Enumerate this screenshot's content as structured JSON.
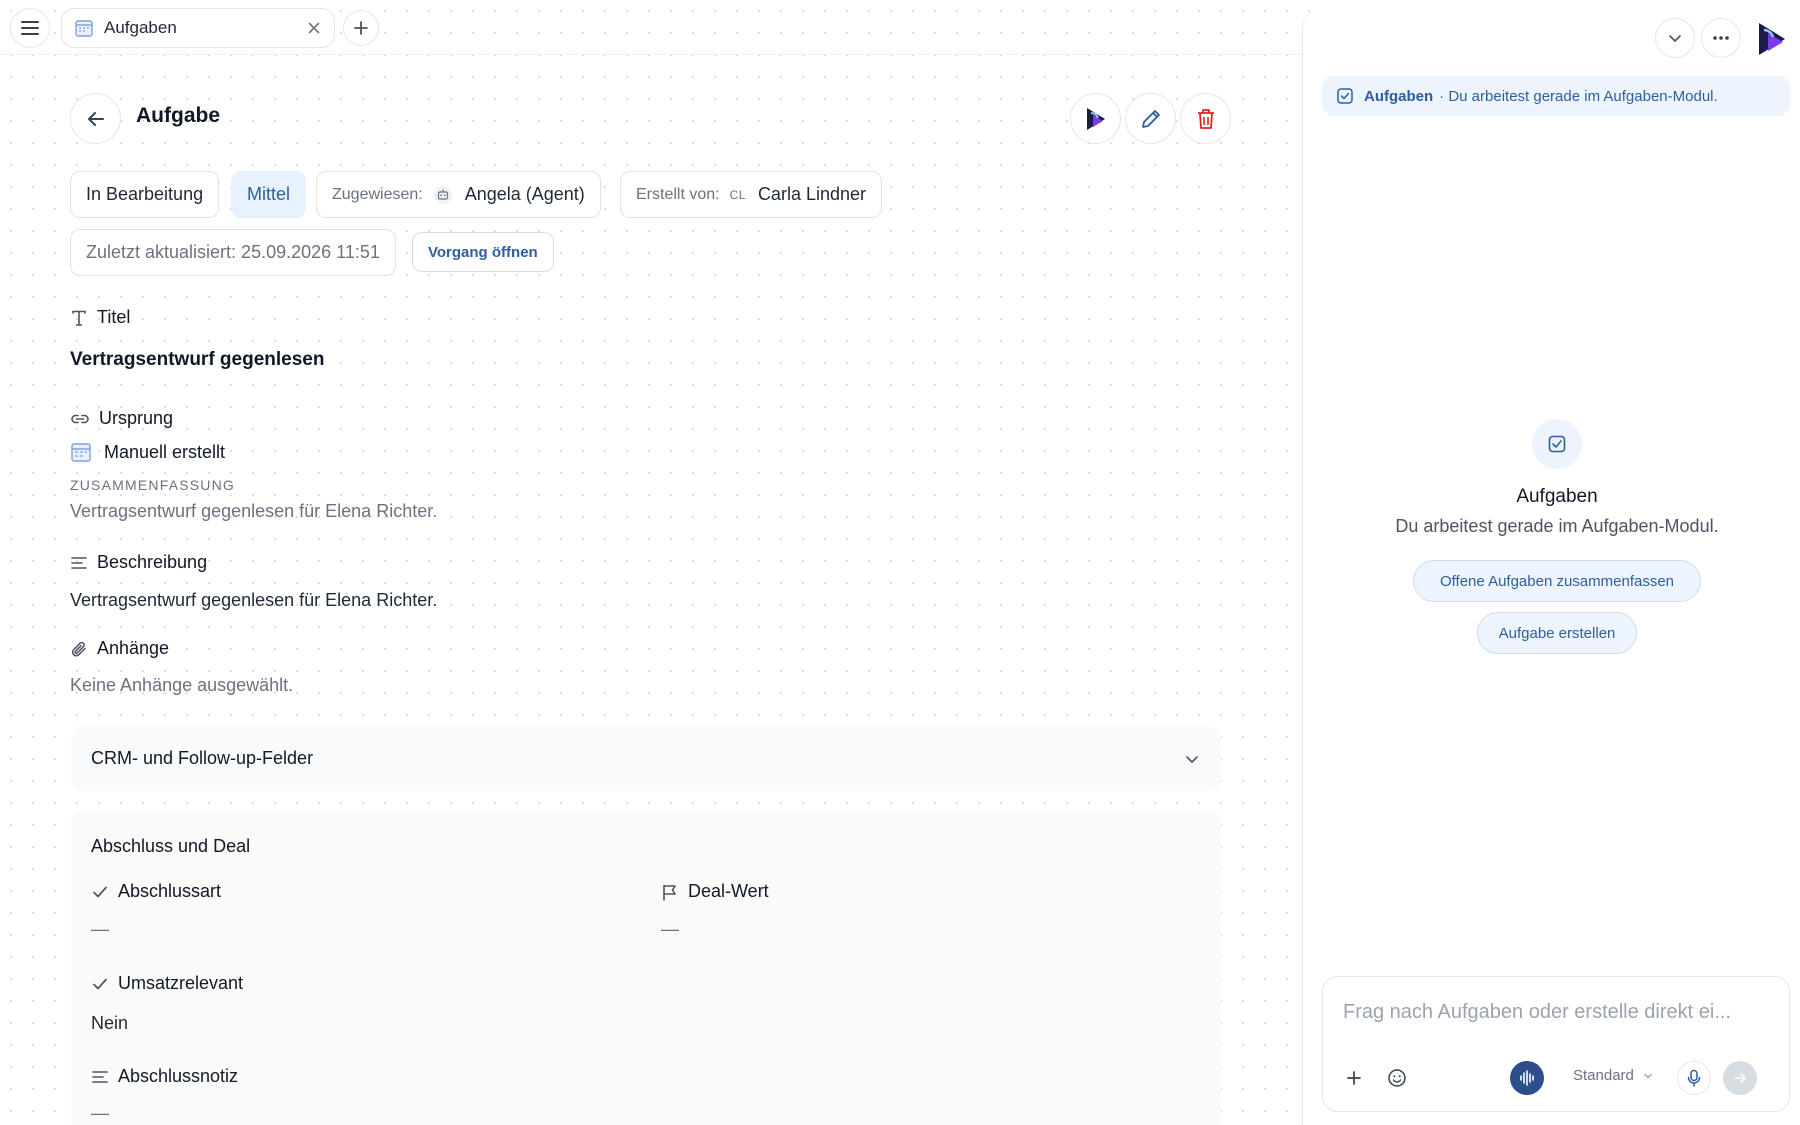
{
  "tab": {
    "label": "Aufgaben"
  },
  "header": {
    "title": "Aufgabe"
  },
  "chips": {
    "status": "In Bearbeitung",
    "priority": "Mittel",
    "assigned_label": "Zugewiesen:",
    "assigned_value": "Angela (Agent)",
    "created_by_label": "Erstellt von:",
    "created_by_initials": "CL",
    "created_by_value": "Carla Lindner",
    "updated": "Zuletzt aktualisiert: 25.09.2026 11:51",
    "open_process": "Vorgang öffnen"
  },
  "fields": {
    "title_label": "Titel",
    "title_value": "Vertragsentwurf gegenlesen",
    "origin_label": "Ursprung",
    "origin_value": "Manuell erstellt",
    "summary_label": "ZUSAMMENFASSUNG",
    "summary_value": "Vertragsentwurf gegenlesen für Elena Richter.",
    "description_label": "Beschreibung",
    "description_value": "Vertragsentwurf gegenlesen für Elena Richter.",
    "attachments_label": "Anhänge",
    "attachments_value": "Keine Anhänge ausgewählt."
  },
  "crm": {
    "accordion_title": "CRM- und Follow-up-Felder",
    "section_title": "Abschluss und Deal",
    "closing_type_label": "Abschlussart",
    "closing_type_value": "—",
    "deal_value_label": "Deal-Wert",
    "deal_value_value": "—",
    "revenue_relevant_label": "Umsatzrelevant",
    "revenue_relevant_value": "Nein",
    "closing_note_label": "Abschlussnotiz",
    "closing_note_value": "—"
  },
  "assistant": {
    "context_module": "Aufgaben",
    "context_text": "· Du arbeitest gerade im Aufgaben-Modul.",
    "title": "Aufgaben",
    "subtitle": "Du arbeitest gerade im Aufgaben-Modul.",
    "suggestion_1": "Offene Aufgaben zusammenfassen",
    "suggestion_2": "Aufgabe erstellen",
    "input_placeholder": "Frag nach Aufgaben oder erstelle direkt ei...",
    "mode": "Standard"
  },
  "colors": {
    "accent": "#2d5f9e",
    "accent_bg": "#eef4fd",
    "delete": "#dc2626",
    "brand_dark": "#1e1b4b",
    "brand_purple": "#7c3aed"
  }
}
